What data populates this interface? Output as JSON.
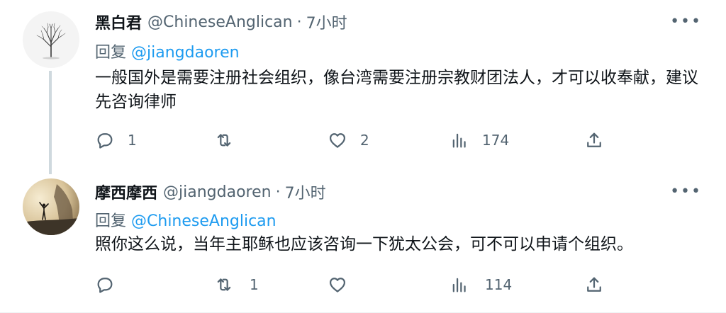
{
  "tweets": [
    {
      "name": "黑白君",
      "handle": "@ChineseAnglican",
      "sep": "·",
      "time": "7小时",
      "more": "•••",
      "reply_prefix": "回复",
      "reply_mention": "@jiangdaoren",
      "text": "一般国外是需要注册社会组织，像台湾需要注册宗教财团法人，才可以收奉献，建议先咨询律师",
      "reply_count": "1",
      "retweet_count": "",
      "like_count": "2",
      "view_count": "174",
      "avatar_icon": "tree-avatar"
    },
    {
      "name": "摩西摩西",
      "handle": "@jiangdaoren",
      "sep": "·",
      "time": "7小时",
      "more": "•••",
      "reply_prefix": "回复",
      "reply_mention": "@ChineseAnglican",
      "text": "照你这么说，当年主耶稣也应该咨询一下犹太公会，可不可以申请个组织。",
      "reply_count": "",
      "retweet_count": "1",
      "like_count": "",
      "view_count": "114",
      "avatar_icon": "figure-avatar"
    }
  ],
  "icons": {
    "reply": "reply-icon",
    "retweet": "retweet-icon",
    "like": "like-icon",
    "views": "views-icon",
    "share": "share-icon"
  },
  "colors": {
    "link": "#1d9bf0",
    "secondary": "#536471",
    "text": "#0f1419"
  }
}
